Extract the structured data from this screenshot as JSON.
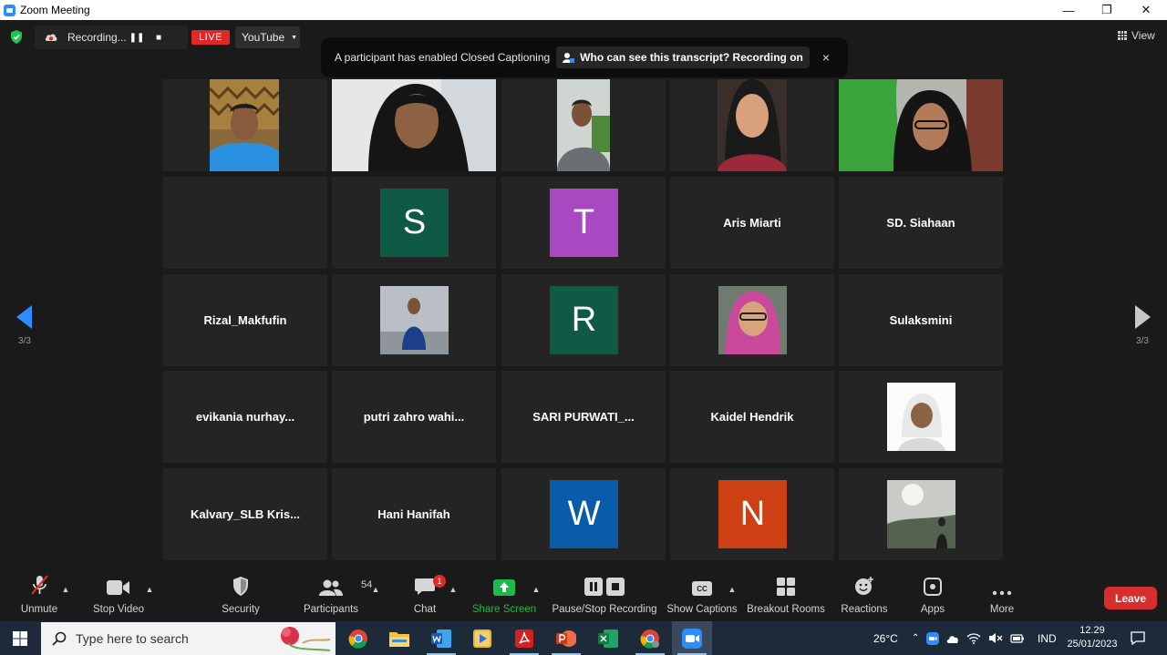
{
  "window": {
    "title": "Zoom Meeting",
    "minimize": "—",
    "restore": "❐",
    "close": "✕"
  },
  "topbar": {
    "recording_label": "Recording...",
    "live_label": "LIVE",
    "stream_target": "YouTube",
    "view_label": "View"
  },
  "banner": {
    "message": "A participant has enabled Closed Captioning",
    "button_label": "Who can see this transcript? Recording on",
    "close": "×"
  },
  "pager": {
    "left": "3/3",
    "right": "3/3"
  },
  "participants": [
    {
      "type": "video"
    },
    {
      "type": "video"
    },
    {
      "type": "video"
    },
    {
      "type": "video"
    },
    {
      "type": "video"
    },
    {
      "type": "blank"
    },
    {
      "type": "avatar",
      "letter": "S",
      "color": "#0e5a44"
    },
    {
      "type": "avatar",
      "letter": "T",
      "color": "#a949c2"
    },
    {
      "type": "name",
      "name": "Aris Miarti"
    },
    {
      "type": "name",
      "name": "SD. Siahaan"
    },
    {
      "type": "name",
      "name": "Rizal_Makfufin"
    },
    {
      "type": "photo"
    },
    {
      "type": "avatar",
      "letter": "R",
      "color": "#0e5a44"
    },
    {
      "type": "photo"
    },
    {
      "type": "name",
      "name": "Sulaksmini"
    },
    {
      "type": "name",
      "name": "evikania  nurhay..."
    },
    {
      "type": "name",
      "name": "putri  zahro  wahi..."
    },
    {
      "type": "name",
      "name": "SARI  PURWATI_..."
    },
    {
      "type": "name",
      "name": "Kaidel Hendrik"
    },
    {
      "type": "photo"
    },
    {
      "type": "name",
      "name": "Kalvary_SLB  Kris..."
    },
    {
      "type": "name",
      "name": "Hani Hanifah"
    },
    {
      "type": "avatar",
      "letter": "W",
      "color": "#0b5bab"
    },
    {
      "type": "avatar",
      "letter": "N",
      "color": "#cc4014"
    },
    {
      "type": "photo"
    }
  ],
  "toolbar": {
    "unmute": "Unmute",
    "stop_video": "Stop Video",
    "security": "Security",
    "participants": "Participants",
    "participants_count": "54",
    "chat": "Chat",
    "chat_badge": "1",
    "share_screen": "Share Screen",
    "pause_stop_recording": "Pause/Stop Recording",
    "show_captions": "Show Captions",
    "captions_icon_text": "CC",
    "breakout_rooms": "Breakout Rooms",
    "reactions": "Reactions",
    "apps": "Apps",
    "more": "More",
    "leave": "Leave"
  },
  "taskbar": {
    "search_placeholder": "Type here to search",
    "temperature": "26°C",
    "language": "IND",
    "time": "12.29",
    "date": "25/01/2023",
    "apps": [
      "chrome-icon",
      "file-explorer-icon",
      "word-icon",
      "media-player-icon",
      "acrobat-icon",
      "powerpoint-icon",
      "excel-icon",
      "chrome-profile-icon",
      "zoom-icon"
    ]
  },
  "colors": {
    "accent": "#2d8cff",
    "leave": "#d62d2d",
    "share": "#1fb84a",
    "live": "#e02828"
  }
}
